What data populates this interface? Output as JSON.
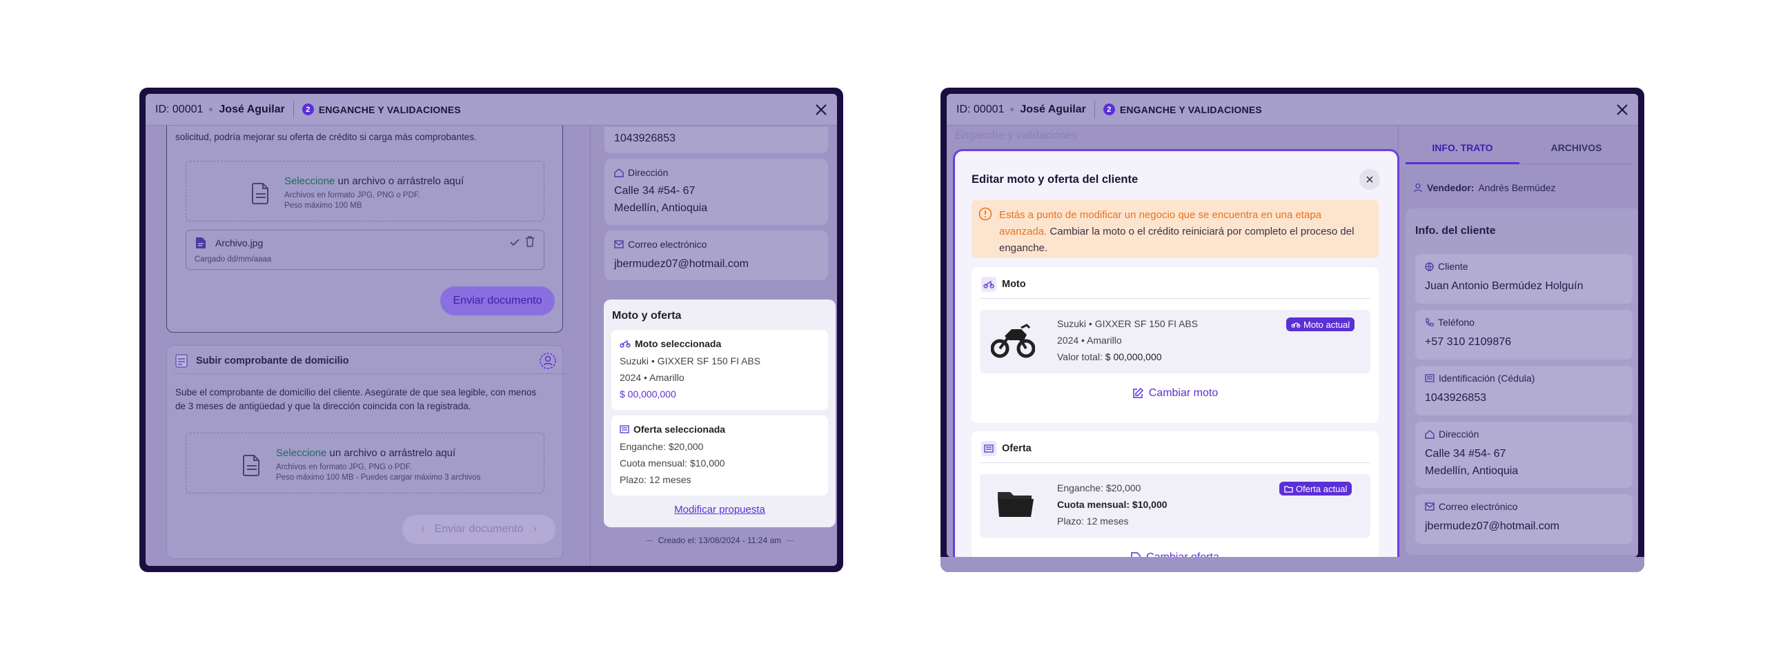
{
  "header": {
    "id_text": "ID: 00001",
    "name": "José Aguilar",
    "step_number": "2",
    "stage": "ENGANCHE Y VALIDACIONES"
  },
  "left": {
    "top_text": "solicitud, podría mejorar su oferta de crédito si carga más comprobantes.",
    "dz1": {
      "select": "Seleccione",
      "rest": " un archivo o arrástrelo aquí",
      "line1": "Archivos en formato JPG, PNG o PDF.",
      "line2": "Peso máximo 100 MB"
    },
    "file": {
      "name": "Archivo.jpg",
      "date": "Cargado dd/mm/aaaa"
    },
    "send_button": "Enviar documento",
    "domicilio": {
      "title": "Subir comprobante de domicilio",
      "desc1": "Sube el comprobante de domicilio del cliente. Asegúrate de que sea legible, con menos",
      "desc2": "de 3 meses de antigüedad y que la dirección coincida con la registrada.",
      "dz": {
        "select": "Seleccione",
        "rest": " un archivo o arrástrelo aquí",
        "line1": "Archivos en formato JPG, PNG o PDF.",
        "line2": "Peso máximo 100 MB - Puedes cargar máximo 3 archivos"
      },
      "send_button": "Enviar documento"
    },
    "right_col": {
      "id_value": "1043926853",
      "direccion_label": "Dirección",
      "direccion_1": "Calle 34 #54- 67",
      "direccion_2": "Medellín, Antioquia",
      "correo_label": "Correo electrónico",
      "correo_value": "jbermudez07@hotmail.com",
      "moto_oferta_title": "Moto y oferta",
      "moto_sel_label": "Moto seleccionada",
      "moto_line1": "Suzuki • GIXXER SF 150 FI ABS",
      "moto_line2": "2024 • Amarillo",
      "moto_price": "$ 00,000,000",
      "oferta_sel_label": "Oferta seleccionada",
      "oferta_line1": "Enganche: $20,000",
      "oferta_line2": "Cuota mensual: $10,000",
      "oferta_line3": "Plazo: 12 meses",
      "modificar": "Modificar propuesta",
      "created": "Creado el: 13/08/2024 - 11:24 am"
    }
  },
  "right": {
    "bg_text": "Enganche y validaciones",
    "tabs": [
      "INFO. TRATO",
      "ARCHIVOS"
    ],
    "vendedor_label": "Vendedor:",
    "vendedor_value": "Andrés Bermúdez",
    "info_title": "Info. del cliente",
    "fields": [
      {
        "label": "Cliente",
        "value": "Juan Antonio Bermúdez Holguín"
      },
      {
        "label": "Teléfono",
        "value": "+57 310 2109876"
      },
      {
        "label": "Identificación (Cédula)",
        "value": "1043926853"
      },
      {
        "label": "Dirección",
        "value": "Calle 34 #54- 67",
        "value2": "Medellín, Antioquia"
      },
      {
        "label": "Correo electrónico",
        "value": "jbermudez07@hotmail.com"
      }
    ],
    "modal": {
      "title": "Editar moto y oferta del cliente",
      "warning_bold": "Estás a punto de modificar un negocio que se encuentra en una etapa avanzada.",
      "warning_rest": " Cambiar la moto o el crédito reiniciará por completo el proceso del enganche.",
      "moto_section": "Moto",
      "moto_line1": "Suzuki • GIXXER SF 150 FI ABS",
      "moto_line2": "2024 • Amarillo",
      "moto_valor_label": "Valor total:",
      "moto_valor": "$ 00,000,000",
      "moto_badge": "Moto actual",
      "cambiar_moto": "Cambiar moto",
      "oferta_section": "Oferta",
      "oferta_line1": "Enganche: $20,000",
      "oferta_line2": "Cuota mensual: $10,000",
      "oferta_line3": "Plazo: 12 meses",
      "oferta_badge": "Oferta actual",
      "cambiar_oferta": "Cambiar oferta"
    }
  },
  "colors": {
    "frame": "#1a0d3f",
    "overlay": "#9d94c4",
    "accent": "#5b2fd6",
    "warning_bg": "#fde4cf",
    "warning_text": "#e8731c"
  }
}
